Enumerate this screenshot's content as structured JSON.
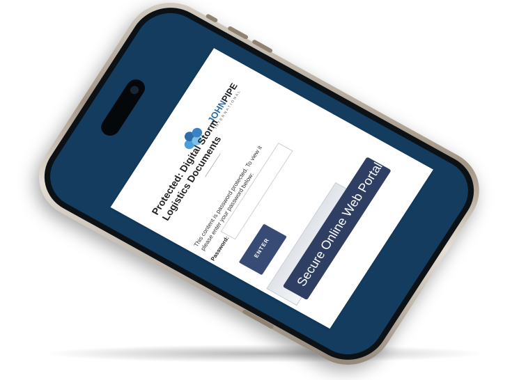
{
  "brand": {
    "name_john": "JOHN",
    "name_pipe": "PIPE",
    "subtitle": "INTERNATIONAL"
  },
  "page": {
    "title_line1": "Protected: Digital Storm",
    "title_line2": "Logistics Documents",
    "protected_text_line1": "This content is password protected. To view it",
    "protected_text_line2": "please enter your password below:",
    "password_label": "Password:",
    "enter_label": "ENTER",
    "portal_label": "Secure Online Web Portal"
  },
  "colors": {
    "screen_background": "#133c5f",
    "button": "#374b74",
    "brand_blue": "#2d6da8"
  }
}
